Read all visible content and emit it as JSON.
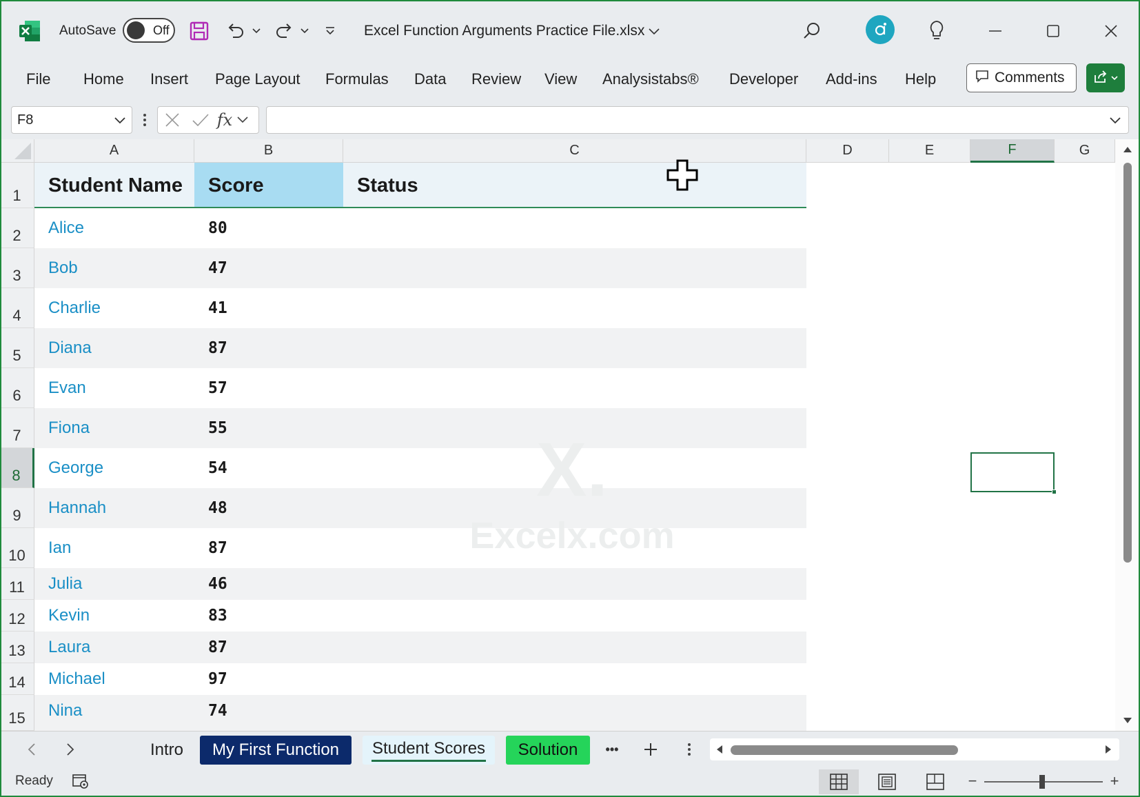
{
  "titlebar": {
    "autosave_label": "AutoSave",
    "autosave_state": "Off",
    "document_title": "Excel Function Arguments Practice File.xlsx"
  },
  "ribbon": {
    "tabs": [
      "File",
      "Home",
      "Insert",
      "Page Layout",
      "Formulas",
      "Data",
      "Review",
      "View",
      "Analysistabs®",
      "Developer",
      "Add-ins",
      "Help"
    ],
    "comments_label": "Comments"
  },
  "formula_bar": {
    "name_box": "F8",
    "fx_label": "fx",
    "formula": ""
  },
  "grid": {
    "columns": [
      "A",
      "B",
      "C",
      "D",
      "E",
      "F",
      "G"
    ],
    "active_column": "F",
    "active_row": "8",
    "header_row": {
      "A": "Student Name",
      "B": "Score",
      "C": "Status"
    },
    "rows": [
      {
        "row": "2",
        "name": "Alice",
        "score": "80"
      },
      {
        "row": "3",
        "name": "Bob",
        "score": "47"
      },
      {
        "row": "4",
        "name": "Charlie",
        "score": "41"
      },
      {
        "row": "5",
        "name": "Diana",
        "score": "87"
      },
      {
        "row": "6",
        "name": "Evan",
        "score": "57"
      },
      {
        "row": "7",
        "name": "Fiona",
        "score": "55"
      },
      {
        "row": "8",
        "name": "George",
        "score": "54"
      },
      {
        "row": "9",
        "name": "Hannah",
        "score": "48"
      },
      {
        "row": "10",
        "name": "Ian",
        "score": "87"
      },
      {
        "row": "11",
        "name": "Julia",
        "score": "46"
      },
      {
        "row": "12",
        "name": "Kevin",
        "score": "83"
      },
      {
        "row": "13",
        "name": "Laura",
        "score": "87"
      },
      {
        "row": "14",
        "name": "Michael",
        "score": "97"
      },
      {
        "row": "15",
        "name": "Nina",
        "score": "74"
      }
    ],
    "watermark": {
      "mark": "X.",
      "site": "Excelx.com"
    }
  },
  "sheet_tabs": [
    {
      "label": "Intro",
      "color": "#e9ecef"
    },
    {
      "label": "My First Function",
      "color": "#0c2a6b"
    },
    {
      "label": "Student Scores",
      "color": "#e4f4fb",
      "active": true
    },
    {
      "label": "Solution",
      "color": "#25d45a"
    }
  ],
  "more_tabs_label": "•••",
  "statusbar": {
    "ready": "Ready",
    "zoom_minus": "−",
    "zoom_plus": "+"
  },
  "colors": {
    "accent_green": "#217346",
    "name_blue": "#1a8fc6",
    "header_blue": "#a8dcf2",
    "copilot": "#1fa6c0"
  }
}
